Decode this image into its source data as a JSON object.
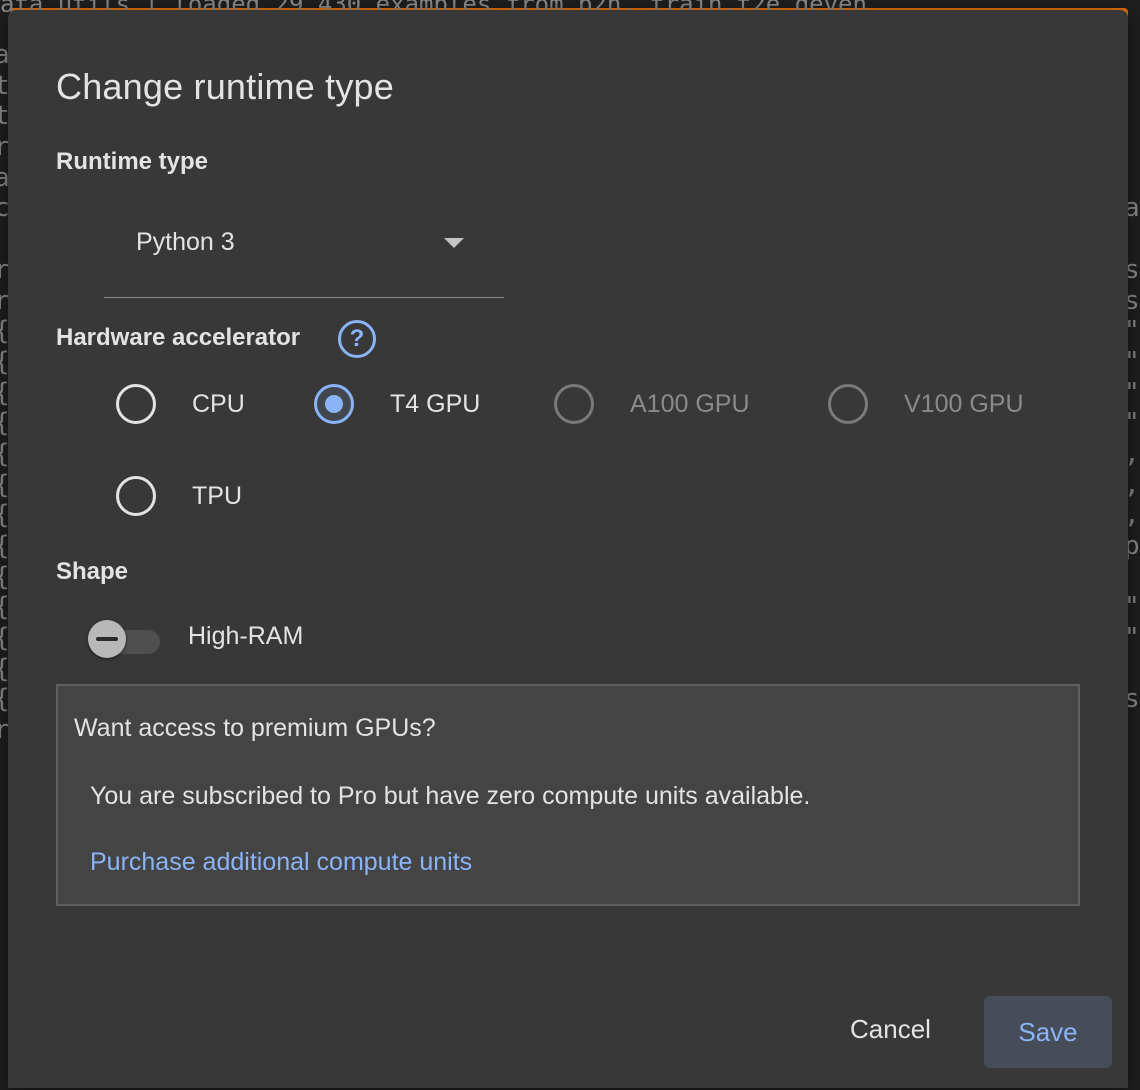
{
  "background": {
    "top_line": "ata_utils  | loaded 29,430 examples from b2n, train.t2e deven",
    "left_gutter": [
      "a",
      "t",
      "t",
      "r",
      "a",
      "c",
      "",
      "r",
      "r",
      "{",
      "{",
      "{",
      "{",
      "{",
      "{",
      "{",
      "{",
      "{",
      "{",
      "{",
      "{",
      "{",
      "r"
    ],
    "right_gutter": [
      "",
      "",
      "",
      "",
      "",
      "a",
      "",
      "s",
      "s",
      "\"",
      "\"",
      "\"",
      "\"",
      ",",
      ",",
      ",",
      "p",
      "",
      "\"",
      "\"",
      "",
      "s"
    ]
  },
  "dialog": {
    "title": "Change runtime type",
    "runtime_type": {
      "label": "Runtime type",
      "selected": "Python 3"
    },
    "hardware": {
      "label": "Hardware accelerator",
      "help_glyph": "?",
      "options": [
        {
          "label": "CPU",
          "checked": false,
          "disabled": false
        },
        {
          "label": "T4 GPU",
          "checked": true,
          "disabled": false
        },
        {
          "label": "A100 GPU",
          "checked": false,
          "disabled": true
        },
        {
          "label": "V100 GPU",
          "checked": false,
          "disabled": true
        },
        {
          "label": "TPU",
          "checked": false,
          "disabled": false
        }
      ]
    },
    "shape": {
      "label": "Shape",
      "toggle_label": "High-RAM",
      "toggle_on": false
    },
    "premium": {
      "title": "Want access to premium GPUs?",
      "text": "You are subscribed to Pro but have zero compute units available.",
      "link": "Purchase additional compute units"
    },
    "buttons": {
      "cancel": "Cancel",
      "save": "Save"
    }
  },
  "colors": {
    "accent": "#8ab4f8",
    "dialog_bg": "#383838",
    "progress": "#e8710a"
  }
}
